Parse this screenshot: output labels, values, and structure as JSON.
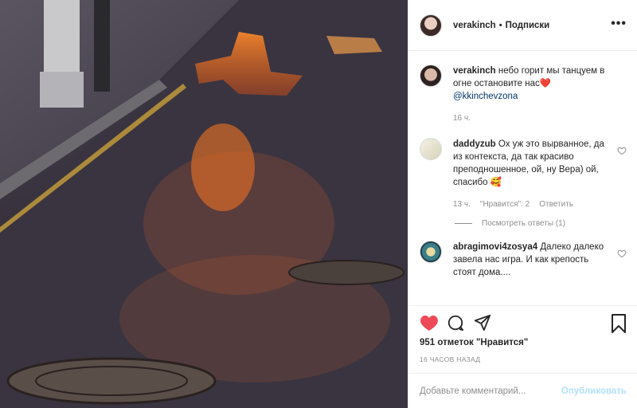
{
  "header": {
    "username": "verakinch",
    "separator": "•",
    "follow_label": "Подписки",
    "more_label": "•••",
    "more_icon": "more-horizontal-icon"
  },
  "caption": {
    "username": "verakinch",
    "text": "небо горит мы танцуем в огне остановите нас",
    "emoji": "❤️",
    "mention": "@kkinchevzona",
    "time": "16 ч."
  },
  "comments": [
    {
      "username": "daddyzub",
      "text": "Ох уж это вырванное, да из контекста, да так красиво преподношенное, ой, ну Вера) ой, спасибо",
      "emoji": "🥰",
      "time": "13 ч.",
      "likes": "\"Нравится\": 2",
      "reply_label": "Ответить",
      "view_replies": "Посмотреть ответы (1)"
    },
    {
      "username": "abragimovi4zosya4",
      "text": "Далеко далеко завела нас игра. И как крепость стоят дома...."
    }
  ],
  "actions": {
    "like_icon": "heart-filled-icon",
    "comment_icon": "comment-icon",
    "share_icon": "paper-plane-icon",
    "save_icon": "bookmark-icon",
    "like_color": "#ed4956",
    "likes_text": "951 отметок \"Нравится\"",
    "time_ago": "16 ЧАСОВ НАЗАД"
  },
  "add_comment": {
    "placeholder": "Добавьте комментарий...",
    "publish_label": "Опубликовать",
    "publish_color": "#b2dffc"
  }
}
